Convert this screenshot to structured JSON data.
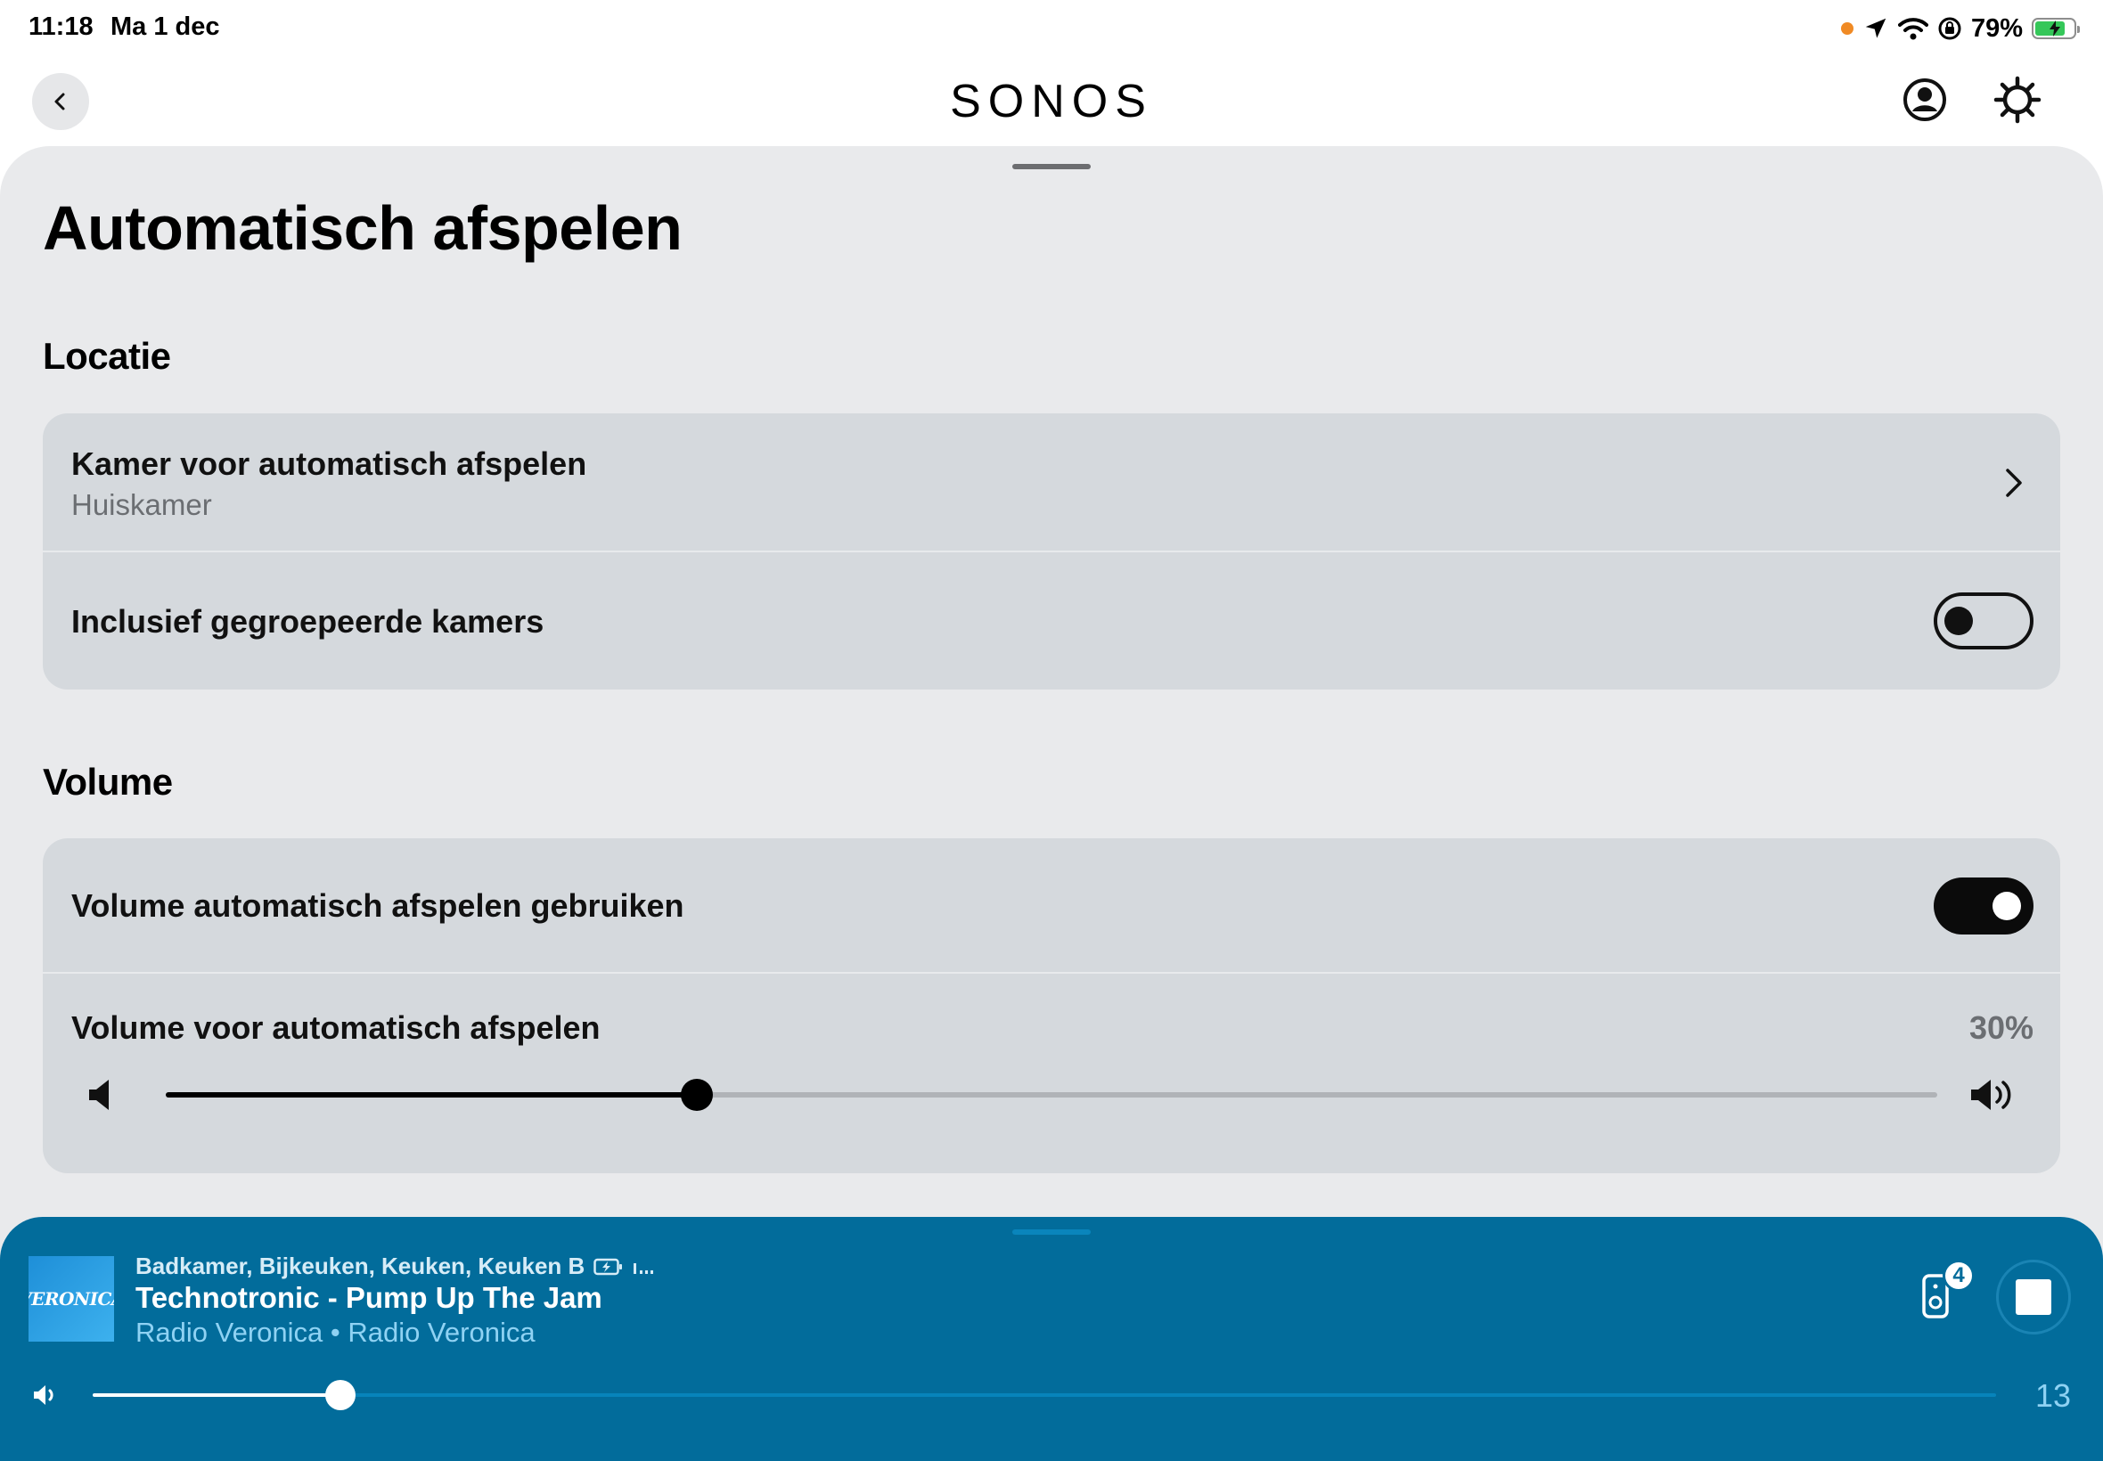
{
  "status_bar": {
    "time": "11:18",
    "date": "Ma 1 dec",
    "battery_percent": "79%",
    "battery_level": 0.79,
    "icons": [
      "orange-dot-indicator",
      "location-icon",
      "wifi-icon",
      "screen-lock-rotation-icon",
      "battery-charging-icon"
    ]
  },
  "header": {
    "logo": "SONOS",
    "icons": [
      "back-chevron-icon",
      "account-icon",
      "gear-icon"
    ]
  },
  "page": {
    "title": "Automatisch afspelen"
  },
  "location_section": {
    "title": "Locatie",
    "room_row": {
      "label": "Kamer voor automatisch afspelen",
      "value": "Huiskamer"
    },
    "grouped_row": {
      "label": "Inclusief gegroepeerde kamers",
      "enabled": false
    }
  },
  "volume_section": {
    "title": "Volume",
    "use_volume_row": {
      "label": "Volume automatisch afspelen gebruiken",
      "enabled": true
    },
    "volume_row": {
      "label": "Volume voor automatisch afspelen",
      "value_text": "30%",
      "level": 0.3
    }
  },
  "now_playing": {
    "rooms": "Badkamer, Bijkeuken, Keuken, Keuken B",
    "track": "Technotronic - Pump Up The Jam",
    "station": "Radio Veronica • Radio Veronica",
    "album_art_text": "VERONICA",
    "speaker_count": "4",
    "volume_value": "13",
    "volume_level": 0.13,
    "colors": {
      "bar_background": "#026c9b",
      "accent_text": "#8fd2f3"
    }
  }
}
